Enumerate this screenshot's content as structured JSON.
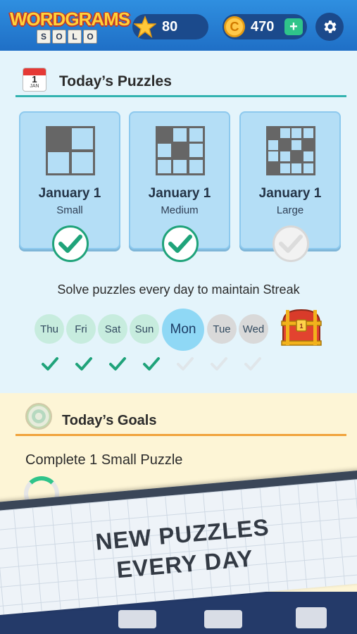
{
  "header": {
    "logo_title": "WORDGRAMS",
    "logo_tiles": [
      "S",
      "O",
      "L",
      "O"
    ],
    "stars": "80",
    "coins": "470",
    "coin_symbol": "C",
    "plus_label": "+",
    "icons": {
      "stars": "star-icon",
      "coins": "coin-icon",
      "add": "plus-icon",
      "settings": "gear-icon"
    }
  },
  "puzzles": {
    "calendar_day": "1",
    "calendar_month": "JAN",
    "title": "Today’s Puzzles",
    "cards": [
      {
        "date": "January 1",
        "size": "Small",
        "completed": true
      },
      {
        "date": "January 1",
        "size": "Medium",
        "completed": true
      },
      {
        "date": "January 1",
        "size": "Large",
        "completed": false
      }
    ]
  },
  "streak": {
    "message": "Solve puzzles every day to maintain Streak",
    "days": [
      {
        "label": "Thu",
        "state": "done"
      },
      {
        "label": "Fri",
        "state": "done"
      },
      {
        "label": "Sat",
        "state": "done"
      },
      {
        "label": "Sun",
        "state": "done"
      },
      {
        "label": "Mon",
        "state": "today"
      },
      {
        "label": "Tue",
        "state": "future"
      },
      {
        "label": "Wed",
        "state": "future"
      }
    ],
    "reward_icon": "treasure-chest-icon"
  },
  "goals": {
    "title": "Today’s Goals",
    "items": [
      {
        "text": "Complete 1 Small Puzzle"
      }
    ]
  },
  "banner": {
    "line1": "NEW PUZZLES",
    "line2": "EVERY DAY"
  },
  "colors": {
    "header": "#1f6fc6",
    "puzzle_bg": "#e4f4fb",
    "goals_bg": "#fdf5d6",
    "check_green": "#1fa37a",
    "teal_divider": "#33b3b0",
    "orange_divider": "#f0a23a"
  }
}
